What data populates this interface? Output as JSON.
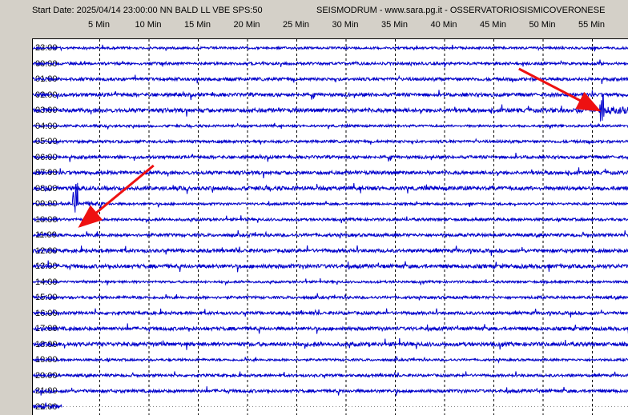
{
  "header": {
    "start_info": "Start Date: 2025/04/14 23:00:00 NN BALD LL VBE SPS:50",
    "station_info": "SEISMODRUM - www.sara.pg.it - OSSERVATORIOSISMICOVERONESE"
  },
  "chart_data": {
    "type": "line",
    "xlabel": "",
    "ylabel": "",
    "x_unit": "Min",
    "x_ticks": [
      "5 Min",
      "10 Min",
      "15 Min",
      "20 Min",
      "25 Min",
      "30 Min",
      "35 Min",
      "40 Min",
      "45 Min",
      "50 Min",
      "55 Min"
    ],
    "x_range": [
      0,
      60
    ],
    "hours": [
      "23:00",
      "00:00",
      "01:00",
      "02:00",
      "03:00",
      "04:00",
      "05:00",
      "06:00",
      "07:00",
      "08:00",
      "09:00",
      "10:00",
      "11:00",
      "12:00",
      "13:00",
      "14:00",
      "15:00",
      "16:00",
      "17:00",
      "18:00",
      "19:00",
      "20:00",
      "21:00",
      "22:00"
    ],
    "last_hour_recorded_minutes": 1.2,
    "trace_color": "#0000cc",
    "grid": true,
    "events": [
      {
        "hour": "03:00",
        "minute": 56,
        "note": "spike"
      },
      {
        "hour": "09:00",
        "minute": 2.5,
        "note": "spike"
      }
    ],
    "annotations": [
      {
        "type": "arrow",
        "color": "#ee1111",
        "target_hour": "03:00",
        "target_minute": 56
      },
      {
        "type": "arrow",
        "color": "#ee1111",
        "target_hour": "09:00",
        "target_minute": 2.5
      }
    ]
  }
}
